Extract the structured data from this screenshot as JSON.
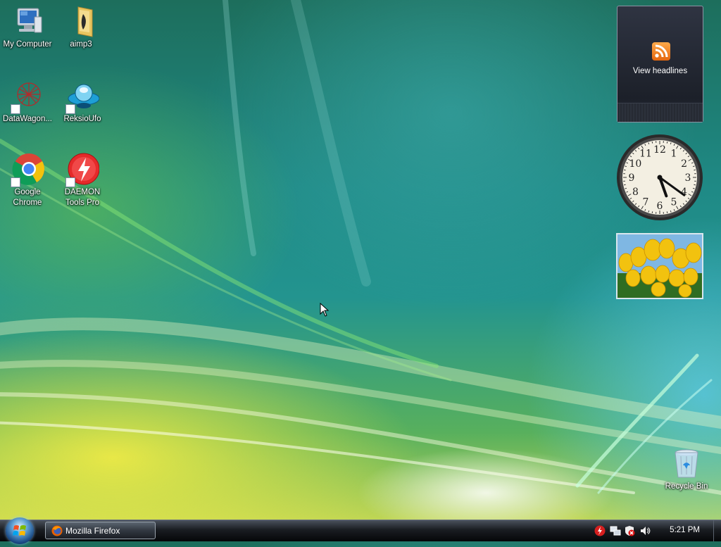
{
  "desktop": {
    "icons": [
      {
        "label": "My Computer"
      },
      {
        "label": "aimp3"
      },
      {
        "label": "DataWagon..."
      },
      {
        "label": "ReksioUfo"
      },
      {
        "label": "Google Chrome"
      },
      {
        "label": "DAEMON Tools Pro"
      },
      {
        "label": "Recycle Bin"
      }
    ]
  },
  "gadgets": {
    "rss": {
      "text": "View headlines",
      "icon": "rss-feed-icon",
      "accent": "#f0801e"
    },
    "clock": {
      "numerals": [
        "12",
        "1",
        "2",
        "3",
        "4",
        "5",
        "6",
        "7",
        "8",
        "9",
        "10",
        "11"
      ],
      "time_shown": "5:21"
    },
    "slideshow": {
      "subject": "yellow-tulips"
    }
  },
  "taskbar": {
    "start_icon": "windows-logo-icon",
    "tasks": [
      {
        "label": "Mozilla Firefox",
        "icon": "firefox-icon"
      }
    ],
    "tray": {
      "icons": [
        "daemon-tools-tray-icon",
        "network-icon",
        "security-alert-icon",
        "volume-icon"
      ],
      "time": "5:21 PM"
    }
  },
  "colors": {
    "taskbar": "#1a1d22",
    "desktop_teal": "#23948f",
    "desktop_yellow": "#d8df52"
  }
}
